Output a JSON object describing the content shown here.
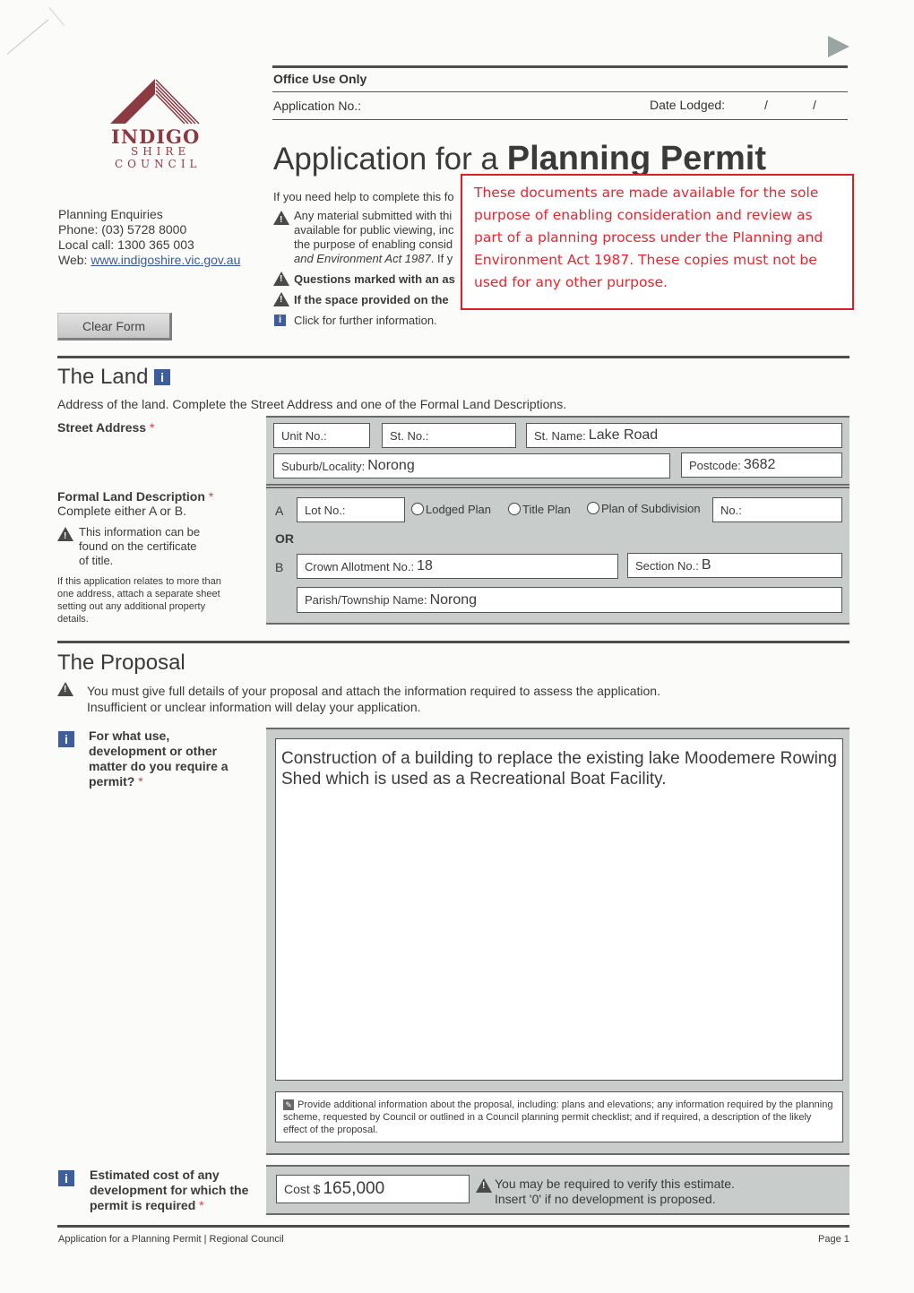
{
  "header": {
    "logo": {
      "line1": "INDIGO",
      "line2": "SHIRE",
      "line3": "COUNCIL",
      "brand_color": "#8b3a42"
    },
    "enquiries": {
      "title": "Planning Enquiries",
      "phone": "Phone: (03) 5728 8000",
      "local_call": "Local call: 1300 365 003",
      "web_label": "Web: ",
      "web_link": "www.indigoshire.vic.gov.au"
    },
    "clear_form_label": "Clear Form",
    "next_icon": "play-arrow-icon"
  },
  "office_use": {
    "title": "Office Use Only",
    "application_no_label": "Application No.:",
    "date_lodged_label": "Date Lodged:",
    "date_separator": "/"
  },
  "title": {
    "prefix": "Application for a ",
    "emphasis": "Planning Permit"
  },
  "help": {
    "intro": "If you need help to complete this fo",
    "material_lines": [
      "Any material submitted with thi",
      "available for public viewing, inc",
      "the purpose of enabling consid"
    ],
    "material_italic": "and Environment Act 1987",
    "material_tail": ". If y",
    "asterisk_note": "Questions marked with an as",
    "space_note": "If the space provided on the",
    "info_note": "Click for further information."
  },
  "notice": {
    "text": "These documents are made available for the sole purpose of enabling consideration and review as part of a planning process under the Planning and Environment Act 1987. These copies must not be used for any other purpose.",
    "color": "#e52630"
  },
  "land": {
    "title": "The Land",
    "description": "Address of the land. Complete the Street Address and one of the Formal Land Descriptions.",
    "street_address_label": "Street Address",
    "required_mark": "*",
    "unit_no": {
      "label": "Unit No.:",
      "value": ""
    },
    "st_no": {
      "label": "St. No.:",
      "value": ""
    },
    "st_name": {
      "label": "St. Name:",
      "value": "Lake Road"
    },
    "suburb": {
      "label": "Suburb/Locality:",
      "value": "Norong"
    },
    "postcode": {
      "label": "Postcode:",
      "value": "3682"
    },
    "formal_label": "Formal Land Description",
    "formal_sub": "Complete either A or B.",
    "certificate_note": "This information can be found on the certificate of title.",
    "multi_address_note": "If this application relates to more than one address, attach a separate sheet setting out any additional property details.",
    "option_a": "A",
    "option_or": "OR",
    "option_b": "B",
    "lot_no": {
      "label": "Lot No.:",
      "value": ""
    },
    "plan_types": [
      "Lodged Plan",
      "Title Plan",
      "Plan of Subdivision"
    ],
    "no": {
      "label": "No.:",
      "value": ""
    },
    "crown_allotment": {
      "label": "Crown Allotment No.:",
      "value": "18"
    },
    "section_no": {
      "label": "Section No.:",
      "value": "B"
    },
    "parish": {
      "label": "Parish/Township Name:",
      "value": "Norong"
    }
  },
  "proposal": {
    "title": "The Proposal",
    "warning_line1": "You must give full details of your proposal and attach the information required to assess the application.",
    "warning_line2": "Insufficient or unclear information will delay your application.",
    "question": "For what use, development or other matter do you require a permit?",
    "required_mark": "*",
    "answer": "Construction of a building to replace the existing lake Moodemere Rowing Shed which is used as a Recreational Boat Facility.",
    "additional_info": "Provide additional information about the proposal, including: plans and elevations; any information required by the planning scheme, requested by Council or outlined in a Council planning permit checklist; and if required, a description of the likely effect of the proposal.",
    "cost_question": "Estimated cost of any development for which the permit is required",
    "cost_label": "Cost $",
    "cost_value": "165,000",
    "cost_note_line1": "You may be required to verify this estimate.",
    "cost_note_line2": "Insert '0' if no development is proposed."
  },
  "footer": {
    "left": "Application for a Planning Permit  |  Regional Council",
    "right": "Page 1"
  }
}
